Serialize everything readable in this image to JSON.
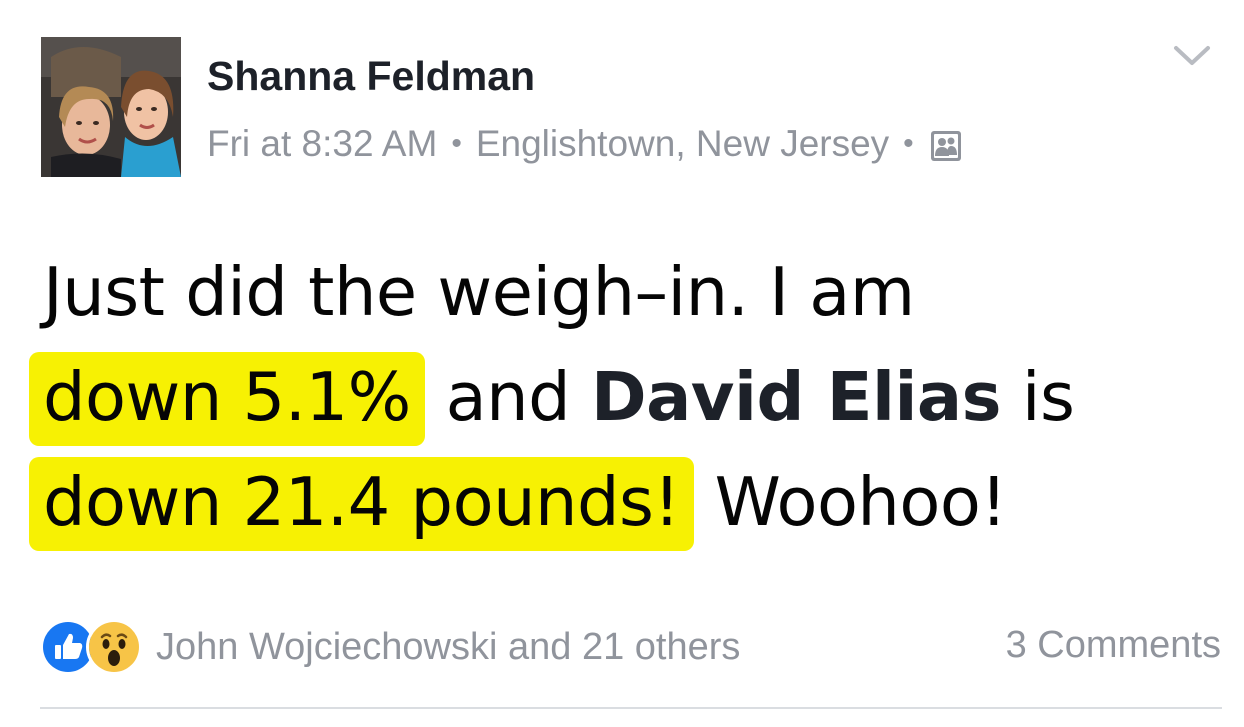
{
  "post": {
    "author_name": "Shanna Feldman",
    "timestamp": "Fri at 8:32 AM",
    "separator": "•",
    "location": "Englishtown, New Jersey",
    "audience_icon": "friends-icon",
    "menu_icon": "chevron-down-icon",
    "avatar_icon": "profile-photo",
    "text": {
      "line1": "Just did the weigh–in. I am",
      "line2_highlight": "down 5.1%",
      "line2_mid": "and",
      "line2_mention": "David Elias",
      "line2_end": "is",
      "line3_highlight": "down 21.4 pounds!",
      "line3_end": "Woohoo!"
    },
    "highlight_color": "#f7f103"
  },
  "reactions": {
    "icons": [
      "like-icon",
      "wow-icon"
    ],
    "names": "John Wojciechowski and 21 others",
    "comments": "3 Comments"
  },
  "colors": {
    "meta_text": "#90949c",
    "author_text": "#1d2129",
    "like_blue": "#1877f2",
    "wow_yellow": "#f7c447"
  }
}
